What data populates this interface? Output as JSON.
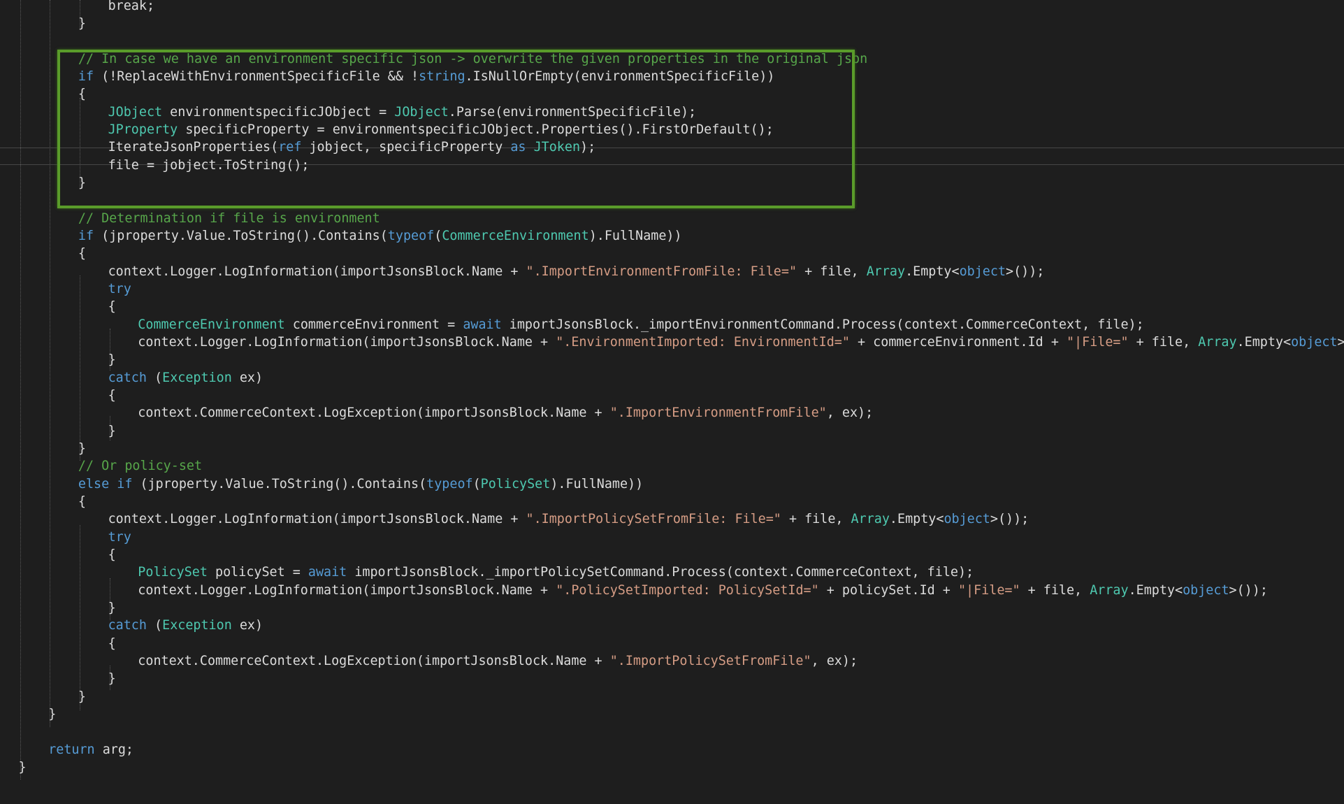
{
  "editor": {
    "colors": {
      "background": "#1e1e1e",
      "plain": "#dcdcdc",
      "keyword": "#569cd6",
      "type": "#4ec9b0",
      "string": "#d69d85",
      "comment": "#57a64a",
      "highlight_border": "#5a9c2a"
    },
    "highlight": {
      "label": "highlighted-code-block",
      "first_line": 3,
      "last_line": 10
    },
    "lines": [
      [
        [
          "plain",
          "break;"
        ]
      ],
      [
        [
          "plain",
          "}"
        ]
      ],
      [],
      [
        [
          "comment",
          "// In case we have an environment specific json -> overwrite the given properties in the original json"
        ]
      ],
      [
        [
          "keyword",
          "if"
        ],
        [
          "plain",
          " (!ReplaceWithEnvironmentSpecificFile && !"
        ],
        [
          "keyword",
          "string"
        ],
        [
          "plain",
          ".IsNullOrEmpty(environmentSpecificFile))"
        ]
      ],
      [
        [
          "plain",
          "{"
        ]
      ],
      [
        [
          "type",
          "JObject"
        ],
        [
          "plain",
          " environmentspecificJObject = "
        ],
        [
          "type",
          "JObject"
        ],
        [
          "plain",
          ".Parse(environmentSpecificFile);"
        ]
      ],
      [
        [
          "type",
          "JProperty"
        ],
        [
          "plain",
          " specificProperty = environmentspecificJObject.Properties().FirstOrDefault();"
        ]
      ],
      [
        [
          "plain",
          "IterateJsonProperties("
        ],
        [
          "keyword",
          "ref"
        ],
        [
          "plain",
          " jobject, specificProperty "
        ],
        [
          "keyword",
          "as"
        ],
        [
          "plain",
          " "
        ],
        [
          "type",
          "JToken"
        ],
        [
          "plain",
          ");"
        ]
      ],
      [
        [
          "plain",
          "file = jobject.ToString();"
        ]
      ],
      [
        [
          "plain",
          "}"
        ]
      ],
      [],
      [
        [
          "comment",
          "// Determination if file is environment"
        ]
      ],
      [
        [
          "keyword",
          "if"
        ],
        [
          "plain",
          " (jproperty.Value.ToString().Contains("
        ],
        [
          "keyword",
          "typeof"
        ],
        [
          "plain",
          "("
        ],
        [
          "type",
          "CommerceEnvironment"
        ],
        [
          "plain",
          ").FullName))"
        ]
      ],
      [
        [
          "plain",
          "{"
        ]
      ],
      [
        [
          "plain",
          "context.Logger.LogInformation(importJsonsBlock.Name + "
        ],
        [
          "string",
          "\".ImportEnvironmentFromFile: File=\""
        ],
        [
          "plain",
          " + file, "
        ],
        [
          "type",
          "Array"
        ],
        [
          "plain",
          ".Empty<"
        ],
        [
          "keyword",
          "object"
        ],
        [
          "plain",
          ">());"
        ]
      ],
      [
        [
          "keyword",
          "try"
        ]
      ],
      [
        [
          "plain",
          "{"
        ]
      ],
      [
        [
          "type",
          "CommerceEnvironment"
        ],
        [
          "plain",
          " commerceEnvironment = "
        ],
        [
          "keyword",
          "await"
        ],
        [
          "plain",
          " importJsonsBlock._importEnvironmentCommand.Process(context.CommerceContext, file);"
        ]
      ],
      [
        [
          "plain",
          "context.Logger.LogInformation(importJsonsBlock.Name + "
        ],
        [
          "string",
          "\".EnvironmentImported: EnvironmentId=\""
        ],
        [
          "plain",
          " + commerceEnvironment.Id + "
        ],
        [
          "string",
          "\"|File=\""
        ],
        [
          "plain",
          " + file, "
        ],
        [
          "type",
          "Array"
        ],
        [
          "plain",
          ".Empty<"
        ],
        [
          "keyword",
          "object"
        ],
        [
          "plain",
          ">());"
        ]
      ],
      [
        [
          "plain",
          "}"
        ]
      ],
      [
        [
          "keyword",
          "catch"
        ],
        [
          "plain",
          " ("
        ],
        [
          "type",
          "Exception"
        ],
        [
          "plain",
          " ex)"
        ]
      ],
      [
        [
          "plain",
          "{"
        ]
      ],
      [
        [
          "plain",
          "context.CommerceContext.LogException(importJsonsBlock.Name + "
        ],
        [
          "string",
          "\".ImportEnvironmentFromFile\""
        ],
        [
          "plain",
          ", ex);"
        ]
      ],
      [
        [
          "plain",
          "}"
        ]
      ],
      [
        [
          "plain",
          "}"
        ]
      ],
      [
        [
          "comment",
          "// Or policy-set"
        ]
      ],
      [
        [
          "keyword",
          "else if"
        ],
        [
          "plain",
          " (jproperty.Value.ToString().Contains("
        ],
        [
          "keyword",
          "typeof"
        ],
        [
          "plain",
          "("
        ],
        [
          "type",
          "PolicySet"
        ],
        [
          "plain",
          ").FullName))"
        ]
      ],
      [
        [
          "plain",
          "{"
        ]
      ],
      [
        [
          "plain",
          "context.Logger.LogInformation(importJsonsBlock.Name + "
        ],
        [
          "string",
          "\".ImportPolicySetFromFile: File=\""
        ],
        [
          "plain",
          " + file, "
        ],
        [
          "type",
          "Array"
        ],
        [
          "plain",
          ".Empty<"
        ],
        [
          "keyword",
          "object"
        ],
        [
          "plain",
          ">());"
        ]
      ],
      [
        [
          "keyword",
          "try"
        ]
      ],
      [
        [
          "plain",
          "{"
        ]
      ],
      [
        [
          "type",
          "PolicySet"
        ],
        [
          "plain",
          " policySet = "
        ],
        [
          "keyword",
          "await"
        ],
        [
          "plain",
          " importJsonsBlock._importPolicySetCommand.Process(context.CommerceContext, file);"
        ]
      ],
      [
        [
          "plain",
          "context.Logger.LogInformation(importJsonsBlock.Name + "
        ],
        [
          "string",
          "\".PolicySetImported: PolicySetId=\""
        ],
        [
          "plain",
          " + policySet.Id + "
        ],
        [
          "string",
          "\"|File=\""
        ],
        [
          "plain",
          " + file, "
        ],
        [
          "type",
          "Array"
        ],
        [
          "plain",
          ".Empty<"
        ],
        [
          "keyword",
          "object"
        ],
        [
          "plain",
          ">());"
        ]
      ],
      [
        [
          "plain",
          "}"
        ]
      ],
      [
        [
          "keyword",
          "catch"
        ],
        [
          "plain",
          " ("
        ],
        [
          "type",
          "Exception"
        ],
        [
          "plain",
          " ex)"
        ]
      ],
      [
        [
          "plain",
          "{"
        ]
      ],
      [
        [
          "plain",
          "context.CommerceContext.LogException(importJsonsBlock.Name + "
        ],
        [
          "string",
          "\".ImportPolicySetFromFile\""
        ],
        [
          "plain",
          ", ex);"
        ]
      ],
      [
        [
          "plain",
          "}"
        ]
      ],
      [
        [
          "plain",
          "}"
        ]
      ],
      [
        [
          "plain",
          "}"
        ]
      ],
      [],
      [
        [
          "keyword",
          "return"
        ],
        [
          "plain",
          " arg;"
        ]
      ],
      [
        [
          "plain",
          "}"
        ]
      ]
    ]
  }
}
